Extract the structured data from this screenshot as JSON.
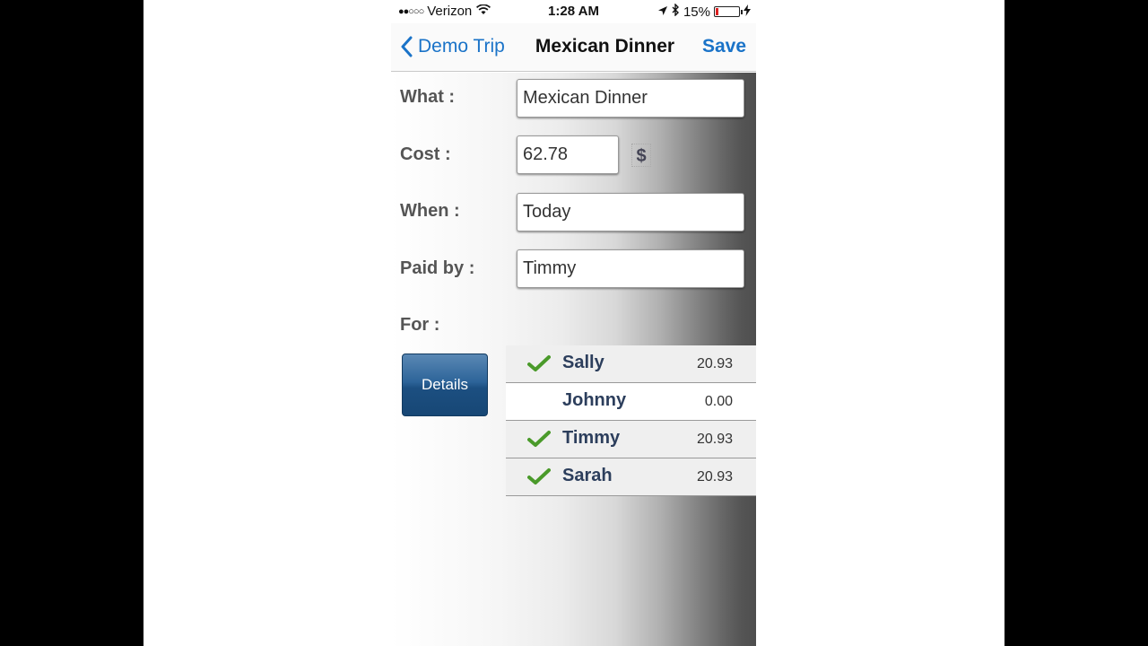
{
  "status_bar": {
    "carrier": "Verizon",
    "signal_dots": "●●○○○",
    "time": "1:28 AM",
    "battery": "15%"
  },
  "nav": {
    "back_label": "Demo Trip",
    "title": "Mexican Dinner",
    "save_label": "Save"
  },
  "form": {
    "what_label": "What :",
    "what_value": "Mexican Dinner",
    "cost_label": "Cost :",
    "cost_value": "62.78",
    "currency": "$",
    "when_label": "When :",
    "when_value": "Today",
    "paid_by_label": "Paid by :",
    "paid_by_value": "Timmy",
    "for_label": "For :"
  },
  "details_label": "Details",
  "people": [
    {
      "name": "Sally",
      "amount": "20.93",
      "checked": true
    },
    {
      "name": "Johnny",
      "amount": "0.00",
      "checked": false
    },
    {
      "name": "Timmy",
      "amount": "20.93",
      "checked": true
    },
    {
      "name": "Sarah",
      "amount": "20.93",
      "checked": true
    }
  ],
  "colors": {
    "accent": "#1a73c8",
    "button": "#1c4f81",
    "check": "#4a9a2a"
  }
}
